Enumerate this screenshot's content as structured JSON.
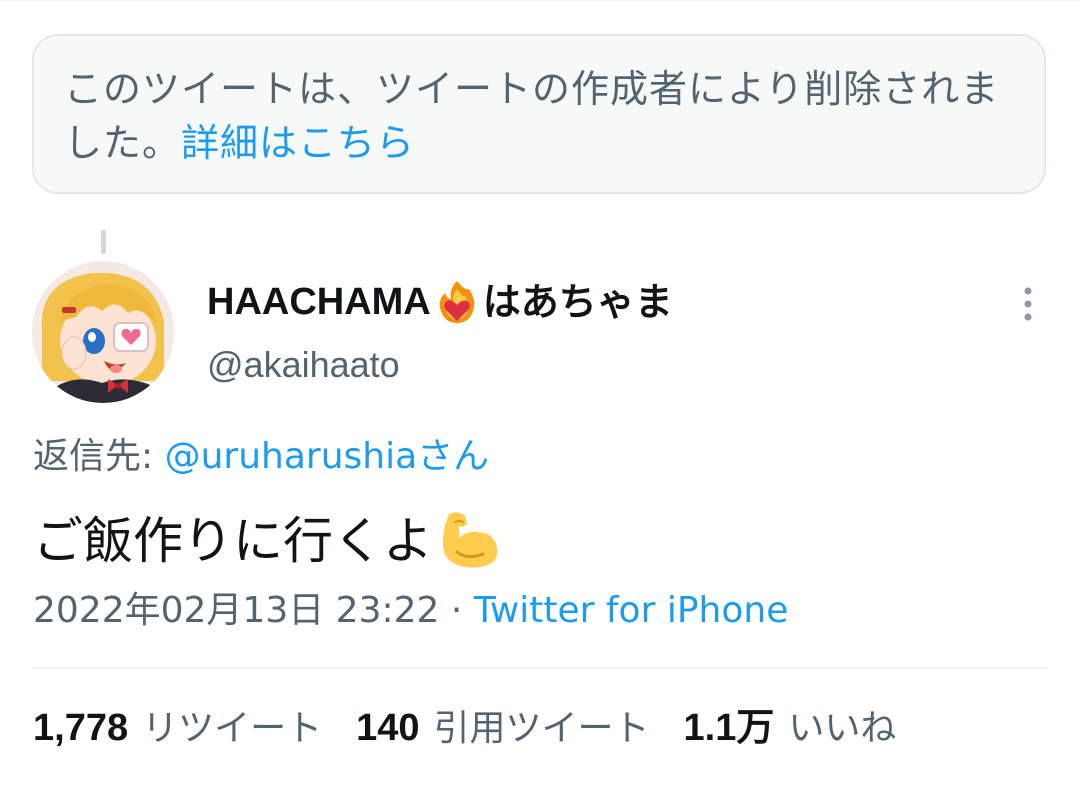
{
  "deleted_notice": {
    "text": "このツイートは、ツイートの作成者により削除されました。",
    "link": "詳細はこちら"
  },
  "author": {
    "name_a": "HAACHAMA",
    "name_b": "はあちゃま",
    "handle": "@akaihaato",
    "name_emoji": "fire-heart-icon"
  },
  "reply": {
    "prefix": "返信先: ",
    "mention": "@uruharushiaさん"
  },
  "tweet": {
    "text": "ご飯作りに行くよ",
    "emoji": "flexed-biceps-icon"
  },
  "meta": {
    "timestamp": "2022年02月13日 23:22",
    "separator": " · ",
    "source": "Twitter for iPhone"
  },
  "stats": {
    "retweets_count": "1,778",
    "retweets_label": "リツイート",
    "quotes_count": "140",
    "quotes_label": "引用ツイート",
    "likes_count": "1.1万",
    "likes_label": "いいね"
  },
  "colors": {
    "link": "#1d9bf0",
    "secondary_text": "#536471",
    "primary_text": "#0f1419"
  }
}
